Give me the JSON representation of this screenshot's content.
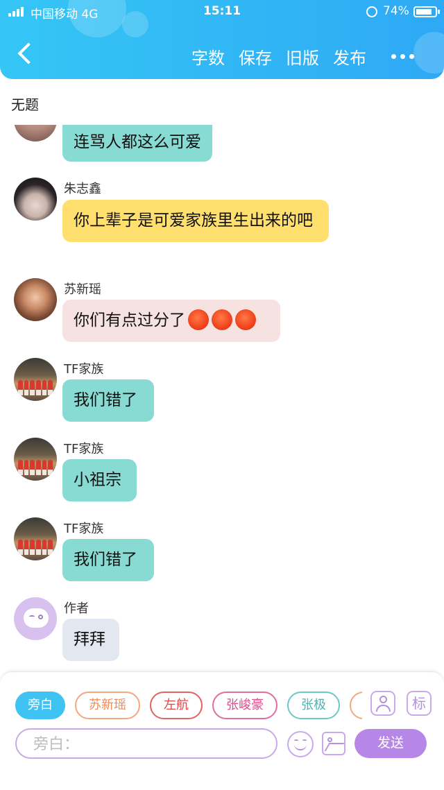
{
  "status_bar": {
    "carrier": "中国移动  4G",
    "time": "15:11",
    "battery": "74%"
  },
  "nav": {
    "actions": [
      "字数",
      "保存",
      "旧版",
      "发布"
    ]
  },
  "doc": {
    "title": "无题"
  },
  "messages": [
    {
      "name": "",
      "text": "连骂人都这么可爱",
      "avatar": "partial-avatar",
      "color": "#88dbd3"
    },
    {
      "name": "朱志鑫",
      "text": "你上辈子是可爱家族里生出来的吧",
      "color": "#ffdf6e"
    },
    {
      "name": "苏新瑶",
      "text": "你们有点过分了",
      "emoji_count": 3,
      "emoji_icon": "angry-face-icon",
      "color": "#f7e2e2"
    },
    {
      "name": "TF家族",
      "text": "我们错了",
      "color": "#88dbd3"
    },
    {
      "name": "TF家族",
      "text": "小祖宗",
      "color": "#88dbd3"
    },
    {
      "name": "TF家族",
      "text": "我们错了",
      "color": "#88dbd3"
    },
    {
      "name": "作者",
      "text": "拜拜",
      "color": "#e2e7f0"
    }
  ],
  "roles": [
    {
      "label": "旁白",
      "active": true,
      "color": "#3ec3f2"
    },
    {
      "label": "苏新瑶",
      "color": "#f3a77d"
    },
    {
      "label": "左航",
      "color": "#e26262"
    },
    {
      "label": "张峻豪",
      "color": "#e46aa0"
    },
    {
      "label": "张极",
      "color": "#6cc8c5"
    },
    {
      "label": "",
      "color": "#f3a77d"
    }
  ],
  "tools": {
    "tag_label": "标",
    "person_icon": "person-icon"
  },
  "composer": {
    "placeholder": "旁白：",
    "send_label": "发送"
  }
}
